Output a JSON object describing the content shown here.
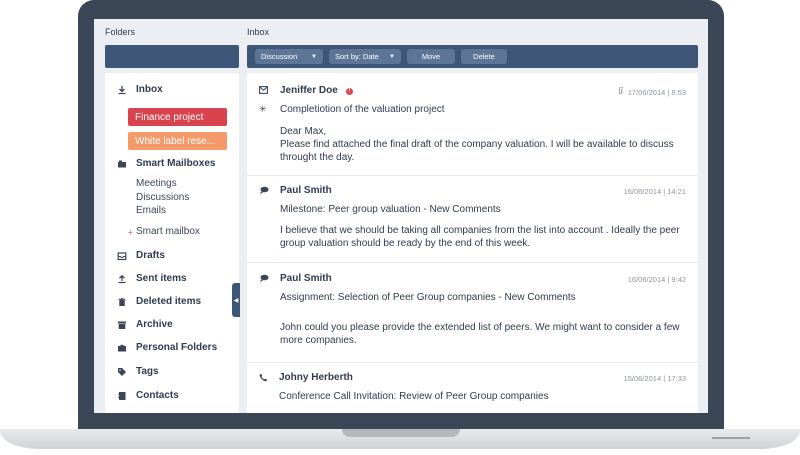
{
  "folders": {
    "title": "Folders",
    "items": [
      {
        "label": "Inbox",
        "icon": "download-icon"
      },
      {
        "label": "Smart Mailboxes",
        "icon": "mailbox-icon"
      },
      {
        "label": "Drafts",
        "icon": "drafts-icon"
      },
      {
        "label": "Sent items",
        "icon": "upload-icon"
      },
      {
        "label": "Deleted items",
        "icon": "trash-icon"
      },
      {
        "label": "Archive",
        "icon": "archive-icon"
      },
      {
        "label": "Personal Folders",
        "icon": "folder-icon"
      },
      {
        "label": "Tags",
        "icon": "tag-icon"
      },
      {
        "label": "Contacts",
        "icon": "contacts-icon"
      }
    ],
    "tags": [
      {
        "label": "Finance project",
        "color": "#d9434d"
      },
      {
        "label": "White label rese...",
        "color": "#f59a6a"
      }
    ],
    "smart_subitems": [
      "Meetings",
      "Discussions",
      "Emails"
    ],
    "smart_mailbox_label": "Smart mailbox"
  },
  "inbox": {
    "title": "Inbox",
    "toolbar": {
      "discussion_label": "Discussion",
      "sort_label": "Sort by: Date",
      "move_label": "Move",
      "delete_label": "Delete"
    },
    "messages": [
      {
        "sender": "Jeniffer Doe",
        "time": "17/06/2014 | 8:53",
        "subject": "Completiotion of the valuation project",
        "body": "Dear Max,\nPlease find attached the final draft of the company valuation. I will be available to discuss throught the day.",
        "icon": "envelope-icon",
        "alert": "!"
      },
      {
        "sender": "Paul Smith",
        "time": "16/06/2014 | 14:21",
        "subject": "Milestone: Peer group valuation - New Comments",
        "body": "I believe that we should be taking all companies from the list into account . Ideally the peer group valuation should be ready by the end of this week.",
        "icon": "chat-icon"
      },
      {
        "sender": "Paul Smith",
        "time": "16/06/2014 | 9:42",
        "subject": "Assignment: Selection of Peer Group companies - New Comments",
        "body": "John could you please provide the extended list of peers. We might want to consider a few more companies.",
        "icon": "chat-icon"
      },
      {
        "sender": "Johny Herberth",
        "time": "15/06/2014 | 17:33",
        "subject": "Conference Call Invitation: Review of Peer Group  companies",
        "body": "",
        "icon": "phone-icon"
      }
    ]
  },
  "colors": {
    "frame": "#3b4656",
    "accent": "#3d5576",
    "tag_red": "#d9434d",
    "tag_orange": "#f59a6a"
  }
}
